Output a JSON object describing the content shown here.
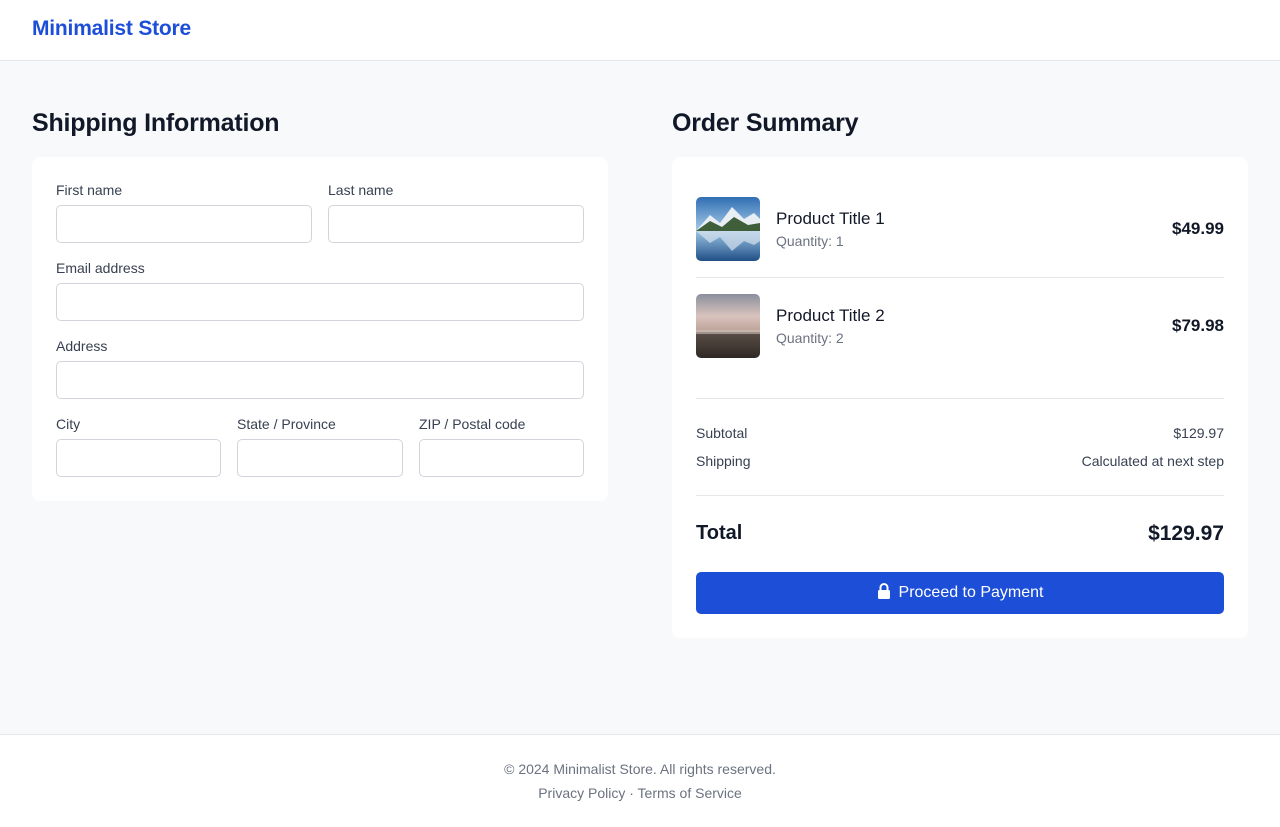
{
  "brand": {
    "name": "Minimalist Store",
    "color": "#1d4ed8"
  },
  "shipping": {
    "title": "Shipping Information",
    "fields": {
      "first_name": {
        "label": "First name",
        "value": ""
      },
      "last_name": {
        "label": "Last name",
        "value": ""
      },
      "email": {
        "label": "Email address",
        "value": ""
      },
      "address": {
        "label": "Address",
        "value": ""
      },
      "city": {
        "label": "City",
        "value": ""
      },
      "state": {
        "label": "State / Province",
        "value": ""
      },
      "zip": {
        "label": "ZIP / Postal code",
        "value": ""
      }
    }
  },
  "summary": {
    "title": "Order Summary",
    "items": [
      {
        "title": "Product Title 1",
        "quantity": "Quantity: 1",
        "price": "$49.99",
        "image": "mountain-lake-image"
      },
      {
        "title": "Product Title 2",
        "quantity": "Quantity: 2",
        "price": "$79.98",
        "image": "misty-field-image"
      }
    ],
    "subtotal": {
      "label": "Subtotal",
      "value": "$129.97"
    },
    "shipping": {
      "label": "Shipping",
      "value": "Calculated at next step"
    },
    "total": {
      "label": "Total",
      "value": "$129.97"
    },
    "button": {
      "label": "Proceed to Payment",
      "icon": "lock-icon",
      "color": "#1d4ed8"
    }
  },
  "footer": {
    "copyright": "© 2024 Minimalist Store. All rights reserved.",
    "privacy": "Privacy Policy",
    "separator": "·",
    "terms": "Terms of Service"
  }
}
